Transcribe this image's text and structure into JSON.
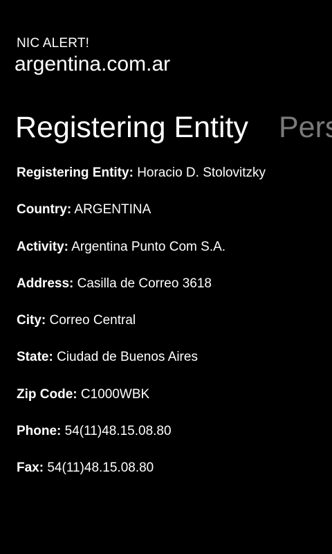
{
  "app": {
    "title": "NIC ALERT!",
    "subtitle": "argentina.com.ar"
  },
  "pivot": {
    "headers": [
      {
        "label": "Registering Entity",
        "active": true
      },
      {
        "label": "Perso",
        "active": false
      }
    ]
  },
  "fields": [
    {
      "label": "Registering Entity:",
      "value": "Horacio D. Stolovitzky"
    },
    {
      "label": "Country:",
      "value": "ARGENTINA"
    },
    {
      "label": "Activity:",
      "value": "Argentina Punto Com S.A."
    },
    {
      "label": "Address:",
      "value": "Casilla de Correo 3618"
    },
    {
      "label": "City:",
      "value": "Correo Central"
    },
    {
      "label": "State:",
      "value": "Ciudad de Buenos Aires"
    },
    {
      "label": "Zip Code:",
      "value": "C1000WBK"
    },
    {
      "label": "Phone:",
      "value": "54(11)48.15.08.80"
    },
    {
      "label": "Fax:",
      "value": "54(11)48.15.08.80"
    }
  ],
  "colors": {
    "background": "#000000",
    "text": "#ffffff",
    "inactive_header": "#7a7a7a"
  }
}
